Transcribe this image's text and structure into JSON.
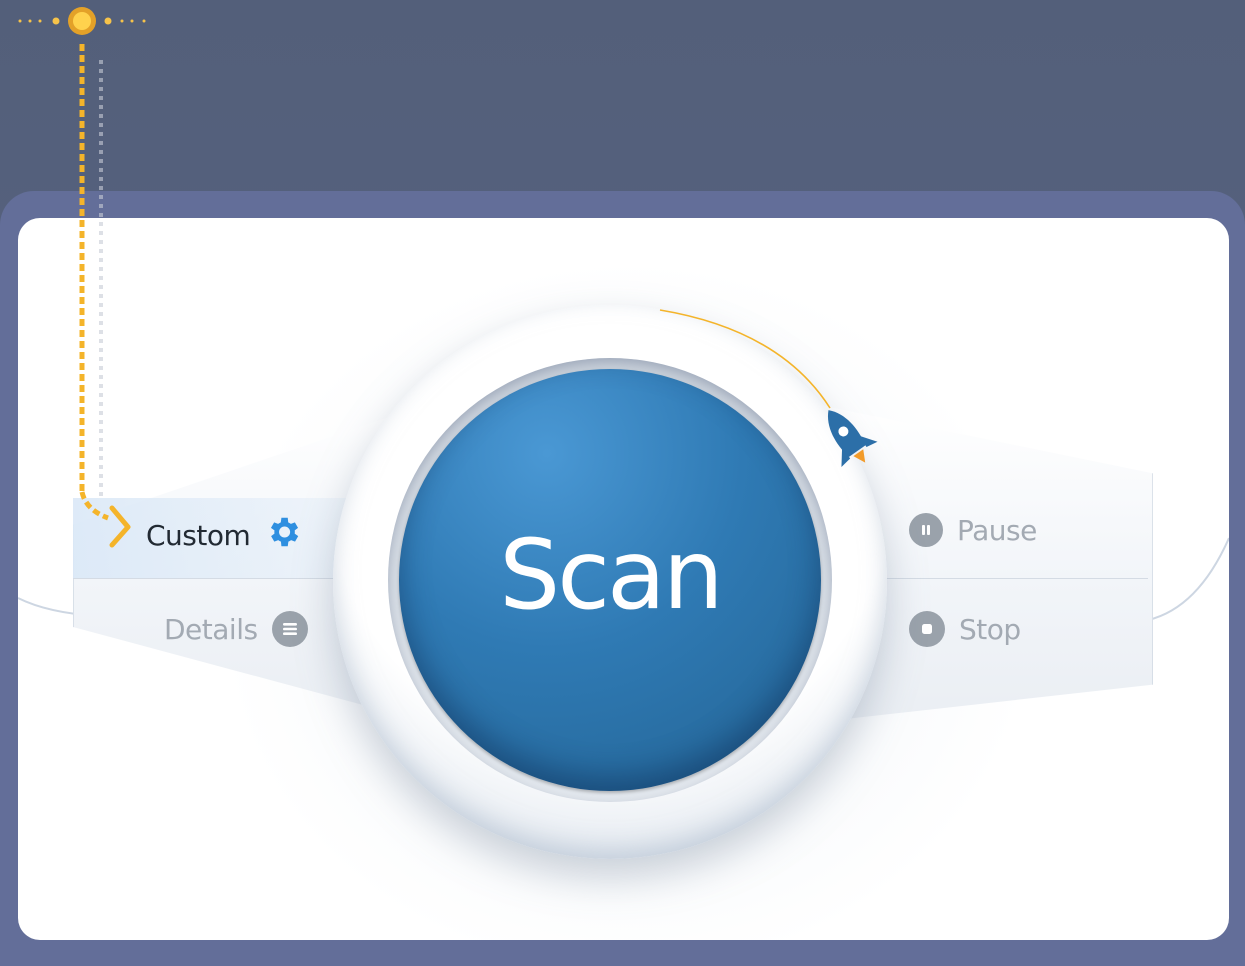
{
  "scan": {
    "label": "Scan"
  },
  "menu": {
    "custom": {
      "label": "Custom",
      "icon": "gear-icon"
    },
    "details": {
      "label": "Details",
      "icon": "list-icon"
    },
    "pause": {
      "label": "Pause",
      "icon": "pause-icon"
    },
    "stop": {
      "label": "Stop",
      "icon": "stop-icon"
    }
  },
  "colors": {
    "accent": "#2f7ab4",
    "highlight": "#f4b42a",
    "muted": "#9aa2ab",
    "frame": "#636e99",
    "background": "#535f7a"
  }
}
